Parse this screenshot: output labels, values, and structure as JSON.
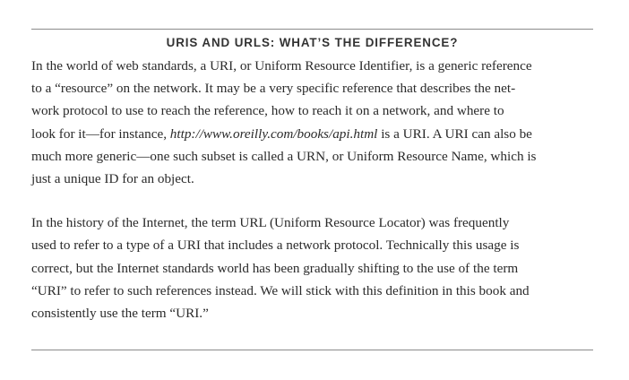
{
  "sidebar": {
    "title": "URIS AND URLS: WHAT’S THE DIFFERENCE?",
    "paragraph1": {
      "line1": "In the world of web standards, a URI, or Uniform Resource Identifier, is a generic reference",
      "line2": "to a “resource” on the network. It may be a very specific reference that describes the net-",
      "line3": "work protocol to use to reach the reference, how to reach it on a network, and where to",
      "line4_before": "look for it—for instance, ",
      "line4_link": "http://www.oreilly.com/books/api.html",
      "line4_after": " is a URI. A URI can also be",
      "line5": "much more generic—one such subset is called a URN, or Uniform Resource Name, which is",
      "line6": "just a unique ID for an object."
    },
    "paragraph2": {
      "line1": "In the history of the Internet, the term URL (Uniform Resource Locator) was frequently",
      "line2": "used to refer to a type of a URI that includes a network protocol. Technically this usage is",
      "line3": "correct, but the Internet standards world has been gradually shifting to the use of the term",
      "line4": "“URI” to refer to such references instead. We will stick with this definition in this book and",
      "line5": "consistently use the term “URI.”"
    }
  }
}
